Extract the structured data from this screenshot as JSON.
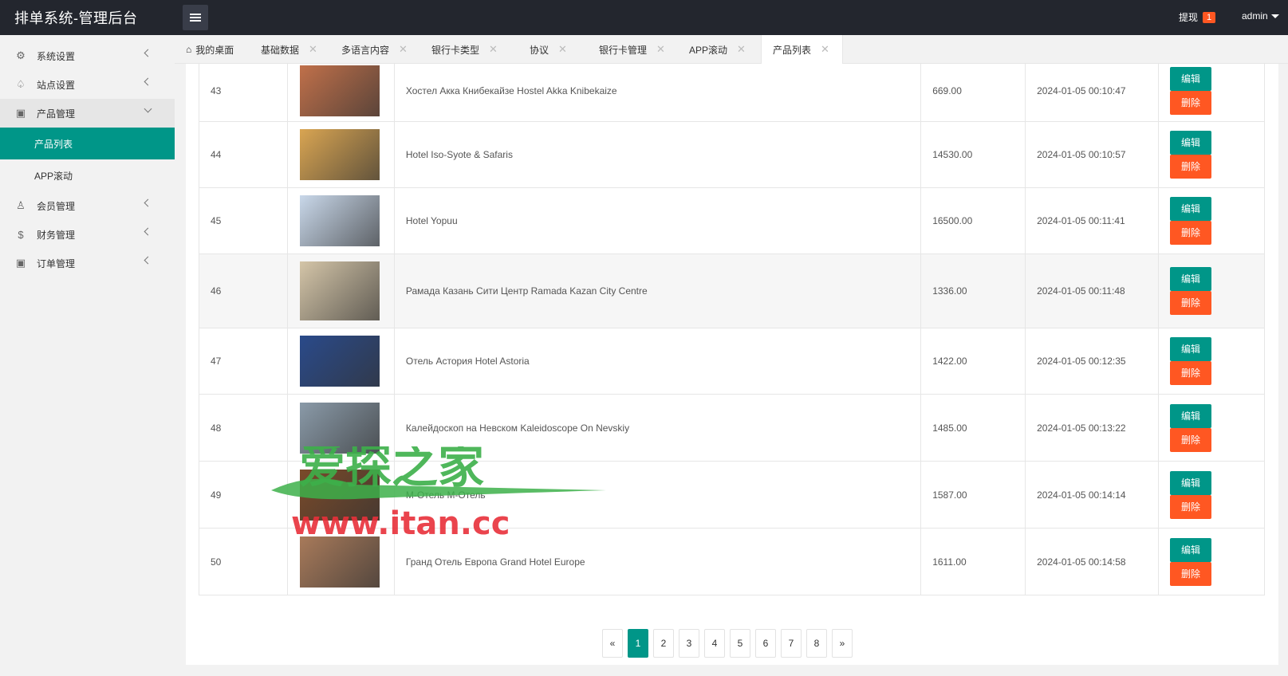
{
  "header": {
    "title": "排单系统-管理后台",
    "withdraw_label": "提现",
    "withdraw_count": "1",
    "user": "admin"
  },
  "sidebar": {
    "items": [
      {
        "label": "系统设置",
        "icon": "gear-icon"
      },
      {
        "label": "站点设置",
        "icon": "bell-icon"
      },
      {
        "label": "产品管理",
        "icon": "box-icon"
      },
      {
        "label": "会员管理",
        "icon": "user-icon"
      },
      {
        "label": "财务管理",
        "icon": "dollar-icon"
      },
      {
        "label": "订单管理",
        "icon": "box-icon"
      }
    ],
    "sub_items": [
      {
        "label": "产品列表"
      },
      {
        "label": "APP滚动"
      }
    ]
  },
  "tabs": [
    {
      "label": "我的桌面"
    },
    {
      "label": "基础数据"
    },
    {
      "label": "多语言内容"
    },
    {
      "label": "银行卡类型"
    },
    {
      "label": "协议"
    },
    {
      "label": "银行卡管理"
    },
    {
      "label": "APP滚动"
    },
    {
      "label": "产品列表"
    }
  ],
  "table": {
    "edit_label": "编辑",
    "delete_label": "删除",
    "rows": [
      {
        "id": "43",
        "name": "Хостел Акка Книбекайзе Hostel Akka Knibekaize",
        "price": "669.00",
        "time": "2024-01-05 00:10:47",
        "color": "#c0704a"
      },
      {
        "id": "44",
        "name": "Hotel Iso-Syote & Safaris",
        "price": "14530.00",
        "time": "2024-01-05 00:10:57",
        "color": "#d9a552"
      },
      {
        "id": "45",
        "name": "Hotel Yopuu",
        "price": "16500.00",
        "time": "2024-01-05 00:11:41",
        "color": "#c9d8ea"
      },
      {
        "id": "46",
        "name": "Рамада Казань Сити Центр Ramada Kazan City Centre",
        "price": "1336.00",
        "time": "2024-01-05 00:11:48",
        "color": "#d4c5a8"
      },
      {
        "id": "47",
        "name": "Отель Астория Hotel Astoria",
        "price": "1422.00",
        "time": "2024-01-05 00:12:35",
        "color": "#2a4a8a"
      },
      {
        "id": "48",
        "name": "Калейдоскоп на Невском Kaleidoscope On Nevskiy",
        "price": "1485.00",
        "time": "2024-01-05 00:13:22",
        "color": "#8a9aa8"
      },
      {
        "id": "49",
        "name": "М-Отель М-Отель",
        "price": "1587.00",
        "time": "2024-01-05 00:14:14",
        "color": "#7a4a2a"
      },
      {
        "id": "50",
        "name": "Гранд Отель Европа Grand Hotel Europe",
        "price": "1611.00",
        "time": "2024-01-05 00:14:58",
        "color": "#a87a5a"
      }
    ]
  },
  "pagination": {
    "prev": "«",
    "pages": [
      "1",
      "2",
      "3",
      "4",
      "5",
      "6",
      "7",
      "8"
    ],
    "current": "1",
    "next": "»"
  },
  "watermark": {
    "line1": "爱探之家",
    "line2": "www.itan.cc"
  }
}
